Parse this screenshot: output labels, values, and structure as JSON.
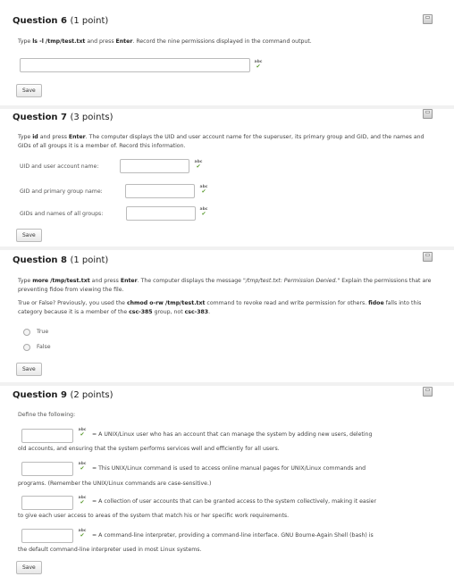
{
  "q6": {
    "title": "Question 6",
    "points": "(1 point)",
    "instruction_pre": "Type ",
    "cmd": "ls -l /tmp/test.txt",
    "instruction_mid": " and press ",
    "key": "Enter",
    "instruction_post": ".  Record the nine permissions displayed in the command output.",
    "input_value": "",
    "save_label": "Save"
  },
  "q7": {
    "title": "Question 7",
    "points": "(3 points)",
    "instruction_pre": "Type ",
    "cmd": "id",
    "instruction_mid": " and press ",
    "key": "Enter",
    "instruction_post": ".  The computer displays the UID and user account name for the superuser, its primary group and GID, and the names and GIDs of all groups it is a member of.  Record this information.",
    "fields": [
      {
        "label": "UID and user account name:",
        "value": ""
      },
      {
        "label": "GID and primary group name:",
        "value": ""
      },
      {
        "label": "GIDs and names of all groups:",
        "value": ""
      }
    ],
    "save_label": "Save"
  },
  "q8": {
    "title": "Question 8",
    "points": "(1 point)",
    "p1_pre": "Type ",
    "p1_cmd": "more /tmp/test.txt",
    "p1_mid": " and press ",
    "p1_key": "Enter",
    "p1_mid2": ".  The computer displays the message \"",
    "p1_msg": "/tmp/test.txt: Permission Denied.",
    "p1_post": "\" Explain the permissions that are preventing fidoe from viewing the file.",
    "p2_pre": "True or False? Previously, you used the ",
    "p2_cmd": "chmod o-rw /tmp/test.txt",
    "p2_mid": " command to revoke read and write permission for others.  ",
    "p2_user": "fidoe",
    "p2_mid2": " falls into this category because it is a member of the ",
    "p2_group1": "csc-385",
    "p2_mid3": " group, not ",
    "p2_group2": "csc-383",
    "p2_post": ".",
    "options": [
      "True",
      "False"
    ],
    "save_label": "Save"
  },
  "q9": {
    "title": "Question 9",
    "points": "(2 points)",
    "intro": "Define the following:",
    "items": [
      {
        "line1": "= A UNIX/Linux user who has an account that can manage the system by adding new users, deleting",
        "line2": "old accounts, and ensuring that the system performs services well and efficiently for all users."
      },
      {
        "line1": "= This UNIX/Linux command is used to access online manual pages for UNIX/Linux commands and",
        "line2": "programs.  (Remember the UNIX/Linux commands are case-sensitive.)"
      },
      {
        "line1": "= A collection of user accounts that can be granted access to the system collectively, making it easier",
        "line2": "to give each user access to areas of the system that match his or her specific work requirements."
      },
      {
        "line1": "= A command-line interpreter, providing a command-line interface.  GNU Bourne-Again Shell (bash) is",
        "line2": "the default command-line interpreter used in most Linux systems."
      }
    ],
    "save_label": "Save"
  },
  "spell_icon_text": "abc",
  "icons": {
    "save_state": "disk-icon",
    "spellcheck": "spellcheck-icon"
  }
}
